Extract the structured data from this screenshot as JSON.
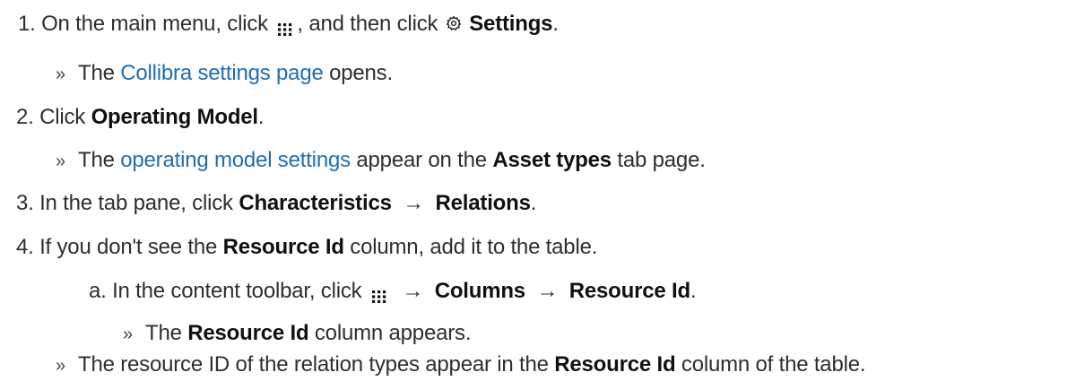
{
  "colors": {
    "link": "#1f6fb2",
    "text": "#2b2f33"
  },
  "icons": {
    "menu": "grid-icon",
    "settings": "gear-icon"
  },
  "steps": [
    {
      "num": "1.",
      "t1": "On the main menu, click",
      "t2": ", and then click",
      "b1": "Settings",
      "t3": ".",
      "result": {
        "t1": "The",
        "link": "Collibra settings page",
        "t2": "opens."
      }
    },
    {
      "num": "2.",
      "t1": "Click",
      "b1": "Operating Model",
      "t2": ".",
      "result": {
        "t1": "The",
        "link": "operating model settings",
        "t2": "appear on the",
        "b1": "Asset types",
        "t3": "tab page."
      }
    },
    {
      "num": "3.",
      "t1": "In the tab pane, click",
      "b1": "Characteristics",
      "arrow": "→",
      "b2": "Relations",
      "t2": "."
    },
    {
      "num": "4.",
      "t1": "If you don't see the",
      "b1": "Resource Id",
      "t2": "column, add it to the table.",
      "substep": {
        "num": "a.",
        "t1": "In the content toolbar, click",
        "arrow1": "→",
        "b1": "Columns",
        "arrow2": "→",
        "b2": "Resource Id",
        "t2": ".",
        "result": {
          "t1": "The",
          "b1": "Resource Id",
          "t2": "column appears."
        }
      },
      "result": {
        "t1": "The resource ID of the relation types appear in the",
        "b1": "Resource Id",
        "t2": "column of the table."
      }
    }
  ],
  "result_marker": "»"
}
